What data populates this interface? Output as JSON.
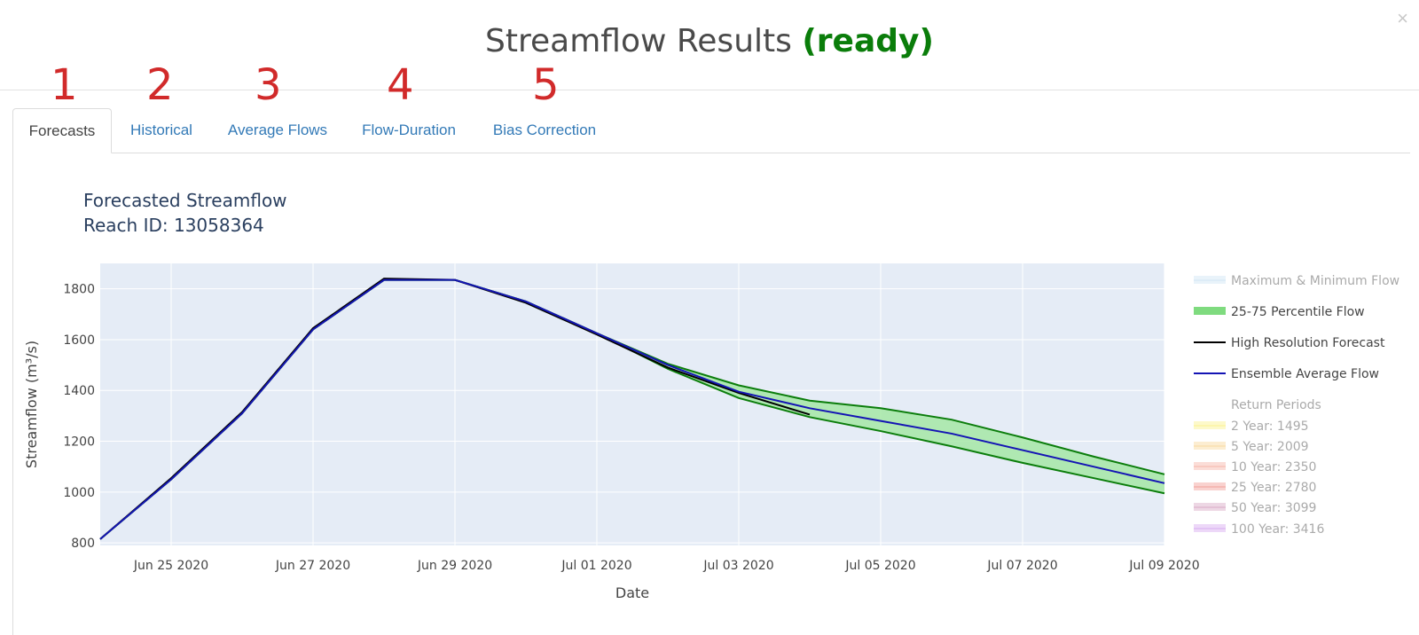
{
  "modal": {
    "title_prefix": "Streamflow Results",
    "status": "(ready)",
    "close": "×"
  },
  "annotations": [
    "1",
    "2",
    "3",
    "4",
    "5"
  ],
  "tabs": [
    {
      "label": "Forecasts",
      "active": true
    },
    {
      "label": "Historical",
      "active": false
    },
    {
      "label": "Average Flows",
      "active": false
    },
    {
      "label": "Flow-Duration",
      "active": false
    },
    {
      "label": "Bias Correction",
      "active": false
    }
  ],
  "chart_data": {
    "type": "area",
    "title": "Forecasted Streamflow",
    "subtitle": "Reach ID: 13058364",
    "xlabel": "Date",
    "ylabel": "Streamflow (m³/s)",
    "x_range": [
      "2020-06-24",
      "2020-07-09"
    ],
    "ylim": [
      790,
      1900
    ],
    "x_ticks": [
      "2020-06-25",
      "2020-06-27",
      "2020-06-29",
      "2020-07-01",
      "2020-07-03",
      "2020-07-05",
      "2020-07-07",
      "2020-07-09"
    ],
    "x_tick_labels": [
      "Jun 25 2020",
      "Jun 27 2020",
      "Jun 29 2020",
      "Jul 01 2020",
      "Jul 03 2020",
      "Jul 05 2020",
      "Jul 07 2020",
      "Jul 09 2020"
    ],
    "y_ticks": [
      800,
      1000,
      1200,
      1400,
      1600,
      1800
    ],
    "grid": true,
    "plot_background": "#e5ecf6",
    "legend_position": "right",
    "series": [
      {
        "name": "25-75 Percentile Flow",
        "kind": "band",
        "color": "#0b7d0b",
        "fill": "#a6e8a6",
        "x": [
          "2020-06-24",
          "2020-06-25",
          "2020-06-26",
          "2020-06-27",
          "2020-06-28",
          "2020-06-29",
          "2020-06-30",
          "2020-07-01",
          "2020-07-02",
          "2020-07-03",
          "2020-07-04",
          "2020-07-05",
          "2020-07-06",
          "2020-07-07",
          "2020-07-08",
          "2020-07-09"
        ],
        "upper": [
          815,
          1050,
          1310,
          1640,
          1835,
          1835,
          1750,
          1625,
          1505,
          1420,
          1360,
          1330,
          1285,
          1215,
          1140,
          1070
        ],
        "lower": [
          815,
          1050,
          1310,
          1640,
          1835,
          1835,
          1750,
          1625,
          1485,
          1370,
          1295,
          1240,
          1180,
          1115,
          1055,
          995
        ]
      },
      {
        "name": "High Resolution Forecast",
        "kind": "line",
        "color": "#000000",
        "x": [
          "2020-06-24",
          "2020-06-25",
          "2020-06-26",
          "2020-06-27",
          "2020-06-28",
          "2020-06-29",
          "2020-06-30",
          "2020-07-01",
          "2020-07-02",
          "2020-07-03",
          "2020-07-04"
        ],
        "values": [
          815,
          1055,
          1315,
          1645,
          1840,
          1835,
          1745,
          1620,
          1490,
          1390,
          1305
        ]
      },
      {
        "name": "Ensemble Average Flow",
        "kind": "line",
        "color": "#1414b4",
        "x": [
          "2020-06-24",
          "2020-06-25",
          "2020-06-26",
          "2020-06-27",
          "2020-06-28",
          "2020-06-29",
          "2020-06-30",
          "2020-07-01",
          "2020-07-02",
          "2020-07-03",
          "2020-07-04",
          "2020-07-05",
          "2020-07-06",
          "2020-07-07",
          "2020-07-08",
          "2020-07-09"
        ],
        "values": [
          815,
          1050,
          1310,
          1640,
          1835,
          1835,
          1750,
          1625,
          1500,
          1395,
          1330,
          1280,
          1230,
          1165,
          1100,
          1035
        ]
      }
    ],
    "legend": [
      {
        "label": "Maximum & Minimum Flow",
        "swatch": "band",
        "color": "#cfe5f5",
        "faded": true
      },
      {
        "label": "25-75 Percentile Flow",
        "swatch": "band",
        "color": "#7fdb7f",
        "faded": false
      },
      {
        "label": "High Resolution Forecast",
        "swatch": "line",
        "color": "#000000",
        "faded": false
      },
      {
        "label": "Ensemble Average Flow",
        "swatch": "line",
        "color": "#1414b4",
        "faded": false
      },
      {
        "label": "Return Periods",
        "swatch": "none",
        "color": "#aaaaaa",
        "faded": true
      },
      {
        "label": "2 Year: 1495",
        "swatch": "band",
        "color": "#fbf28a",
        "faded": true
      },
      {
        "label": "5 Year: 2009",
        "swatch": "band",
        "color": "#f9d79a",
        "faded": true
      },
      {
        "label": "10 Year: 2350",
        "swatch": "band",
        "color": "#f6b3a6",
        "faded": true
      },
      {
        "label": "25 Year: 2780",
        "swatch": "band",
        "color": "#f19b95",
        "faded": true
      },
      {
        "label": "50 Year: 3099",
        "swatch": "band",
        "color": "#d7a6c4",
        "faded": true
      },
      {
        "label": "100 Year: 3416",
        "swatch": "band",
        "color": "#d6a9f0",
        "faded": true
      }
    ]
  }
}
